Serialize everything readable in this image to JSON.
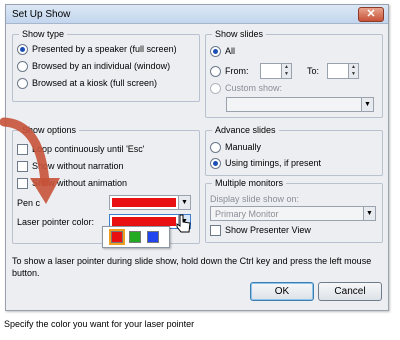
{
  "window": {
    "title": "Set Up Show",
    "close_label": "✕"
  },
  "show_type": {
    "label": "Show type",
    "options": [
      "Presented by a speaker (full screen)",
      "Browsed by an individual (window)",
      "Browsed at a kiosk (full screen)"
    ]
  },
  "show_slides": {
    "label": "Show slides",
    "all": "All",
    "from": "From:",
    "to": "To:",
    "custom": "Custom show:"
  },
  "show_options": {
    "label": "Show options",
    "items": [
      "Loop continuously until 'Esc'",
      "Show without narration",
      "Show without animation"
    ],
    "pen_color": "Pen c",
    "laser_color": "Laser pointer color:"
  },
  "advance_slides": {
    "label": "Advance slides",
    "manually": "Manually",
    "timings": "Using timings, if present"
  },
  "monitors": {
    "label": "Multiple monitors",
    "display_label": "Display slide show on:",
    "display_value": "Primary Monitor",
    "presenter_view": "Show Presenter View"
  },
  "hint": "To show a laser pointer during slide show, hold down the Ctrl key and press the left mouse button.",
  "buttons": {
    "ok": "OK",
    "cancel": "Cancel"
  },
  "status": "Specify the color you want for your laser pointer",
  "colors": {
    "red": "#e81010",
    "green": "#22aa22",
    "blue": "#2244ee",
    "arrow": "#c8523a"
  }
}
